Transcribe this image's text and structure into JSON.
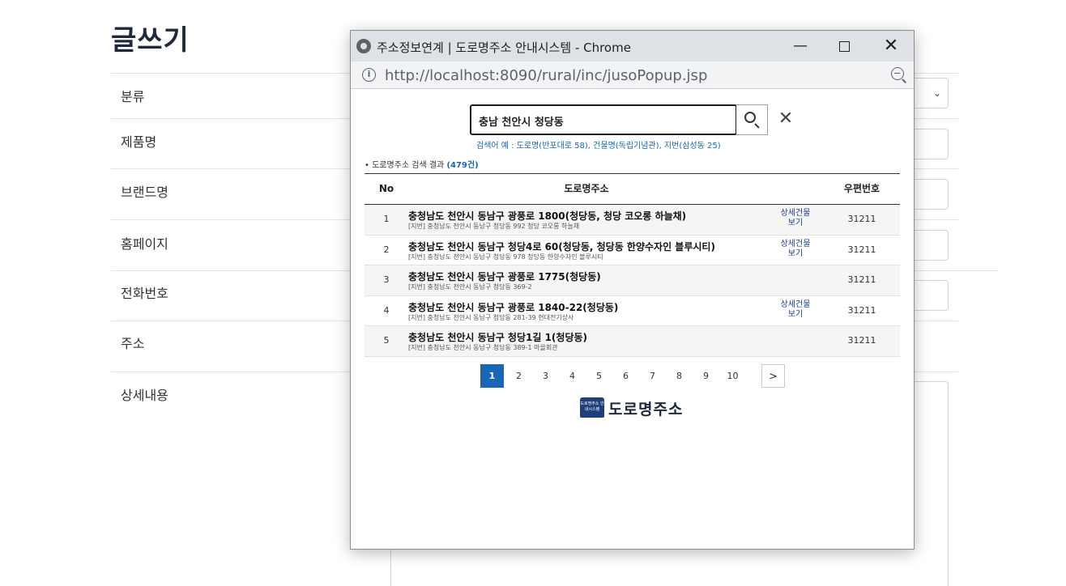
{
  "page": {
    "title": "글쓰기",
    "fields": {
      "category": "분류",
      "product_name": "제품명",
      "brand_name": "브랜드명",
      "homepage": "홈페이지",
      "phone": "전화번호",
      "address": "주소",
      "details": "상세내용"
    }
  },
  "popup": {
    "window_title": "주소정보연계 | 도로명주소 안내시스템 - Chrome",
    "url": "http://localhost:8090/rural/inc/jusoPopup.jsp",
    "search": {
      "value": "충남 천안시 청당동",
      "hint": "검색어 예 : 도로명(반포대로 58), 건물명(독립기념관), 지번(삼성동 25)"
    },
    "result_label": "• 도로명주소 검색 결과",
    "result_count": "(479건)",
    "table": {
      "headers": {
        "no": "No",
        "road": "도로명주소",
        "zip": "우편번호"
      },
      "rows": [
        {
          "no": "1",
          "road": "충청남도 천안시 동남구 광풍로 1800(청당동, 청당 코오롱 하늘채)",
          "jibun": "[지번] 충청남도 천안시 동남구 청당동 992 청당 코오롱 하늘채",
          "detail": "상세건물\n보기",
          "zip": "31211"
        },
        {
          "no": "2",
          "road": "충청남도 천안시 동남구 청당4로 60(청당동, 청당동 한양수자인 블루시티)",
          "jibun": "[지번] 충청남도 천안시 동남구 청당동 978 청당동 한양수자인 블루시티",
          "detail": "상세건물\n보기",
          "zip": "31211"
        },
        {
          "no": "3",
          "road": "충청남도 천안시 동남구 광풍로 1775(청당동)",
          "jibun": "[지번] 충청남도 천안시 동남구 청당동 369-2",
          "detail": "",
          "zip": "31211"
        },
        {
          "no": "4",
          "road": "충청남도 천안시 동남구 광풍로 1840-22(청당동)",
          "jibun": "[지번] 충청남도 천안시 동남구 청당동 281-39 현대전기상사",
          "detail": "상세건물\n보기",
          "zip": "31211"
        },
        {
          "no": "5",
          "road": "충청남도 천안시 동남구 청당1길 1(청당동)",
          "jibun": "[지번] 충청남도 천안시 동남구 청당동 389-1 마을회관",
          "detail": "",
          "zip": "31211"
        }
      ]
    },
    "pagination": {
      "pages": [
        "1",
        "2",
        "3",
        "4",
        "5",
        "6",
        "7",
        "8",
        "9",
        "10"
      ],
      "current": "1",
      "next": ">"
    },
    "logo": {
      "badge": "도로명주소 안내시스템",
      "text": "도로명주소"
    }
  }
}
